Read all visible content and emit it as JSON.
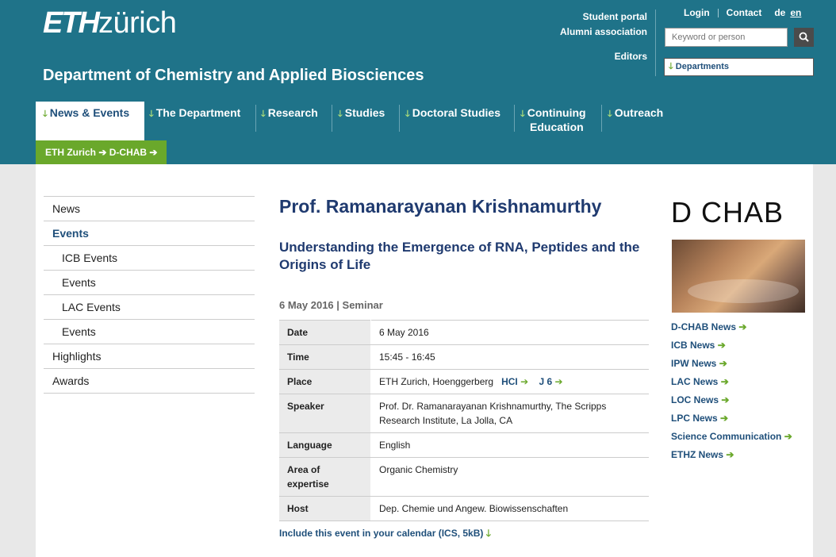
{
  "header": {
    "logo_bold": "ETH",
    "logo_light": "zürich",
    "department": "Department of Chemistry and Applied Biosciences",
    "links": [
      "Student portal",
      "Alumni association"
    ],
    "editors": "Editors",
    "login": "Login",
    "contact": "Contact",
    "lang_de": "de",
    "lang_en": "en",
    "search_placeholder": "Keyword or person",
    "departments": "Departments"
  },
  "nav": {
    "items": [
      "News & Events",
      "The Department",
      "Research",
      "Studies",
      "Doctoral Studies",
      "Continuing Education",
      "Outreach"
    ],
    "arrow": "🡓"
  },
  "breadcrumb": {
    "items": [
      "ETH Zurich",
      "D-CHAB"
    ]
  },
  "sidebar": {
    "items": [
      "News",
      "Events",
      "ICB Events",
      "Events",
      "LAC Events",
      "Events",
      "Highlights",
      "Awards"
    ]
  },
  "event": {
    "title": "Prof. Ramanarayanan Krishnamurthy",
    "subtitle": "Understanding the Emergence of RNA, Peptides and the Origins of Life",
    "meta": "6 May 2016 | Seminar",
    "rows": {
      "date_k": "Date",
      "date_v": "6 May 2016",
      "time_k": "Time",
      "time_v": "15:45 - 16:45",
      "place_k": "Place",
      "place_v": "ETH Zurich, Hoenggerberg",
      "place_l1": "HCI",
      "place_l2": "J 6",
      "speaker_k": "Speaker",
      "speaker_v": "Prof. Dr. Ramanarayanan Krishnamurthy, The Scripps Research Institute, La Jolla, CA",
      "lang_k": "Language",
      "lang_v": "English",
      "area_k": "Area of expertise",
      "area_v": "Organic Chemistry",
      "host_k": "Host",
      "host_v": "Dep. Chemie und Angew. Biowissenschaften"
    },
    "calendar": "Include this event in your calendar (ICS, 5kB)"
  },
  "right": {
    "logo": "D CHAB",
    "links": [
      "D-CHAB News",
      "ICB News",
      "IPW News",
      "LAC News",
      "LOC News",
      "LPC News",
      "Science Communication",
      "ETHZ News"
    ]
  }
}
